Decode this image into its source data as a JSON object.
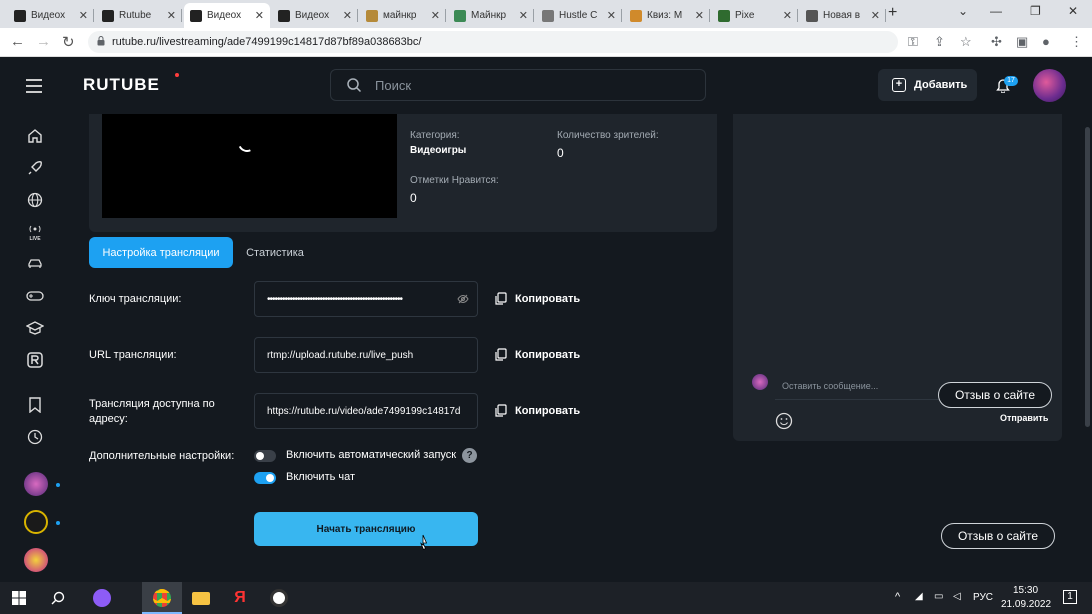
{
  "browser": {
    "tabs": [
      {
        "title": "Видеох",
        "color": "#222"
      },
      {
        "title": "Rutube",
        "color": "#222"
      },
      {
        "title": "Видеох",
        "color": "#222"
      },
      {
        "title": "Видеох",
        "color": "#222"
      },
      {
        "title": "майнкр",
        "color": "#b58a3a"
      },
      {
        "title": "Майнкр",
        "color": "#3c8a55"
      },
      {
        "title": "Hustle C",
        "color": "#777"
      },
      {
        "title": "Квиз: М",
        "color": "#d08a2b"
      },
      {
        "title": "Pixe",
        "color": "#2f6b2f"
      },
      {
        "title": "Новая в",
        "color": "#555"
      }
    ],
    "active_tab_index": 2,
    "url": "rutube.ru/livestreaming/ade7499199c14817d87bf89a038683bc/"
  },
  "header": {
    "logo": "RUTUBE",
    "search_placeholder": "Поиск",
    "add_label": "Добавить",
    "notif_count": "17"
  },
  "stream_info": {
    "category_label": "Категория:",
    "category_value": "Видеоигры",
    "viewers_label": "Количество зрителей:",
    "viewers_value": "0",
    "likes_label": "Отметки Нравится:",
    "likes_value": "0"
  },
  "tabs": {
    "settings": "Настройка трансляции",
    "stats": "Статистика"
  },
  "settings": {
    "key_label": "Ключ трансляции:",
    "key_value": "••••••••••••••••••••••••••••••••••••••••••••••••••••••",
    "url_label": "URL трансляции:",
    "url_value": "rtmp://upload.rutube.ru/live_push",
    "address_label": "Трансляция доступна по адресу:",
    "address_value": "https://rutube.ru/video/ade7499199c14817d",
    "copy_label": "Копировать",
    "extra_label": "Дополнительные настройки:",
    "autostart_label": "Включить автоматический запуск",
    "autostart_on": false,
    "chat_label": "Включить чат",
    "chat_on": true,
    "help_glyph": "?",
    "start_label": "Начать трансляцию"
  },
  "chat": {
    "placeholder": "Оставить сообщение...",
    "send_label": "Отправить"
  },
  "feedback_label": "Отзыв о сайте",
  "taskbar": {
    "lang": "РУС",
    "time": "15:30",
    "date": "21.09.2022",
    "notif_count": "1"
  },
  "colors": {
    "accent": "#1da1f2",
    "background": "#14191f",
    "panel": "#1f252c"
  }
}
